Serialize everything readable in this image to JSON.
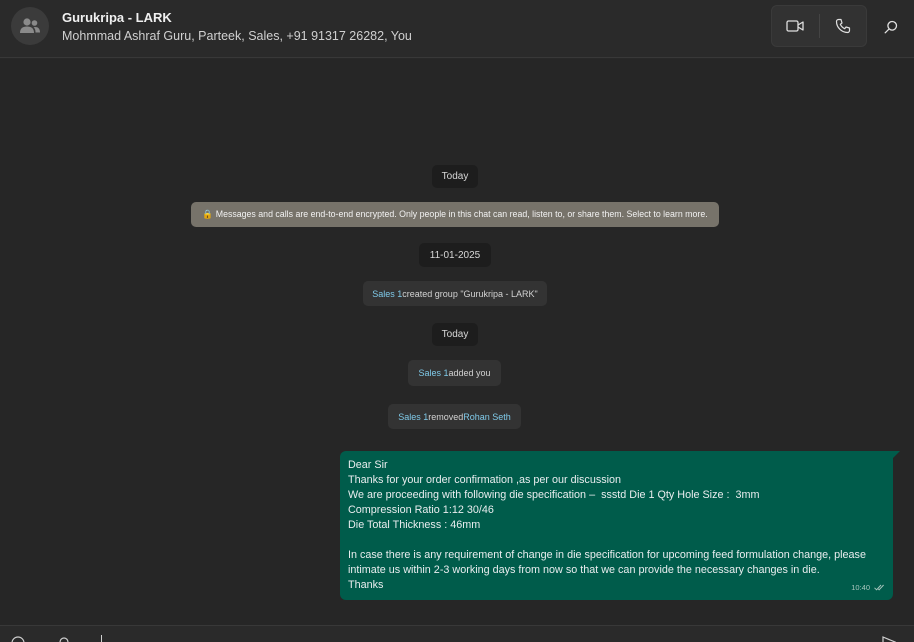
{
  "header": {
    "title": "Gurukripa - LARK",
    "subtitle": "Mohmmad Ashraf Guru, Parteek, Sales, +91 91317 26282, You"
  },
  "messages": {
    "date_pill_1": "Today",
    "encryption_notice": "🔒 Messages and calls are end-to-end encrypted. Only people in this chat can read, listen to, or share them. Select to learn more.",
    "date_pill_2": "11-01-2025",
    "event_created": {
      "actor": "Sales 1",
      "text": " created group \"Gurukripa - LARK\""
    },
    "date_pill_3": "Today",
    "event_added": {
      "actor": "Sales 1",
      "text": " added you"
    },
    "event_removed": {
      "actor": "Sales 1",
      "text": " removed ",
      "target": "Rohan Seth"
    },
    "outgoing": {
      "lines": [
        "Dear Sir",
        "Thanks for your order confirmation ,as per our discussion",
        "We are proceeding with following die specification –  ssstd Die 1 Qty Hole Size :  3mm",
        "Compression Ratio 1:12 30/46",
        "Die Total Thickness : 46mm",
        "",
        "In case there is any requirement of change in die specification for upcoming feed formulation change, please",
        "intimate us within 2-3 working days from now so that we can provide the necessary changes in die.",
        "Thanks"
      ],
      "time": "10:40"
    }
  },
  "icons": {
    "avatar": "group-avatar-icon",
    "video": "video-call-icon",
    "voice": "voice-call-icon",
    "search": "search-icon",
    "read": "double-check-icon"
  },
  "colors": {
    "outgoing_bubble": "#005c4b",
    "encryption_bg": "#77736a",
    "mention": "#7fc9e8"
  }
}
